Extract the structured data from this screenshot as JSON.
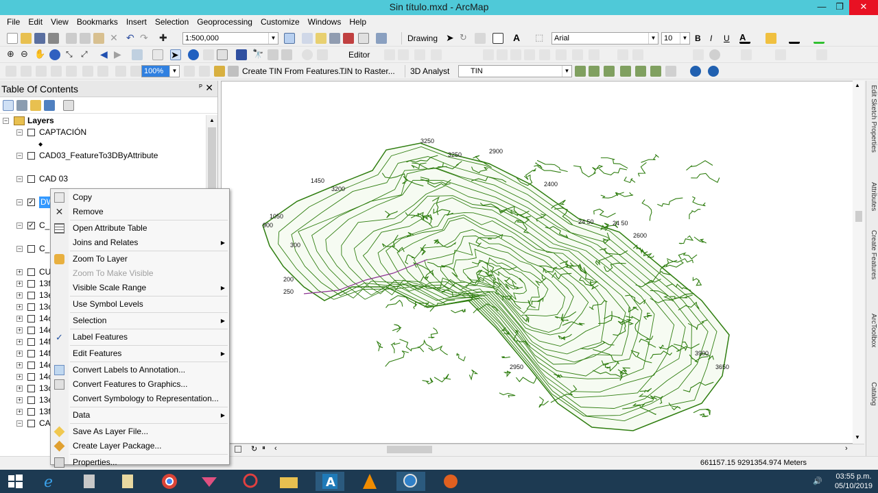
{
  "window": {
    "title": "Sin título.mxd - ArcMap",
    "minimize": "—",
    "maximize": "❐",
    "close": "✕"
  },
  "menu": [
    "File",
    "Edit",
    "View",
    "Bookmarks",
    "Insert",
    "Selection",
    "Geoprocessing",
    "Customize",
    "Windows",
    "Help"
  ],
  "toolbar1": {
    "scale": "1:500,000",
    "drawing": "Drawing",
    "font": "Arial",
    "font_size": "10",
    "bold": "B",
    "italic": "I",
    "underline": "U"
  },
  "toolbar2": {
    "editor": "Editor"
  },
  "toolbar3": {
    "zoom_value": "100%",
    "create_tin": "Create TIN From Features...",
    "tin_to_raster": "TIN to Raster...",
    "analyst": "3D Analyst",
    "tin_layer": "TIN"
  },
  "toc": {
    "title": "Table Of Contents",
    "pin": "ᴾ",
    "close": "✕",
    "root": "Layers",
    "rows": [
      {
        "name": "CAPTACIÓN",
        "exp": "−",
        "checked": false
      },
      {
        "name": "◆",
        "exp": "",
        "checked": null
      },
      {
        "name": "CAD03_FeatureTo3DByAttribute",
        "exp": "−",
        "checked": false
      },
      {
        "name": "CAD 03",
        "exp": "−",
        "checked": false
      },
      {
        "name": "DW",
        "exp": "−",
        "checked": true,
        "selected": true
      },
      {
        "name": "C_",
        "exp": "−",
        "checked": true
      },
      {
        "name": "C_C",
        "exp": "−",
        "checked": false
      },
      {
        "name": "CU",
        "exp": "+",
        "checked": false
      },
      {
        "name": "13f",
        "exp": "+",
        "checked": false
      },
      {
        "name": "13e",
        "exp": "+",
        "checked": false
      },
      {
        "name": "13c",
        "exp": "+",
        "checked": false
      },
      {
        "name": "14c",
        "exp": "+",
        "checked": false
      },
      {
        "name": "14e",
        "exp": "+",
        "checked": false
      },
      {
        "name": "14f",
        "exp": "+",
        "checked": false
      },
      {
        "name": "14f",
        "exp": "+",
        "checked": false
      },
      {
        "name": "14e",
        "exp": "+",
        "checked": false
      },
      {
        "name": "14c",
        "exp": "+",
        "checked": false
      },
      {
        "name": "13c",
        "exp": "+",
        "checked": false
      },
      {
        "name": "13e",
        "exp": "+",
        "checked": false
      },
      {
        "name": "13f",
        "exp": "+",
        "checked": false
      },
      {
        "name": "CA",
        "exp": "−",
        "checked": false
      }
    ]
  },
  "context_menu": {
    "items": [
      {
        "label": "Copy",
        "icon": "copy-icon",
        "sub": false,
        "disabled": false
      },
      {
        "label": "Remove",
        "icon": "remove-icon",
        "sub": false,
        "disabled": false
      },
      {
        "sep": true
      },
      {
        "label": "Open Attribute Table",
        "icon": "table-icon",
        "sub": false,
        "disabled": false
      },
      {
        "label": "Joins and Relates",
        "icon": "",
        "sub": true,
        "disabled": false
      },
      {
        "sep": true
      },
      {
        "label": "Zoom To Layer",
        "icon": "zoom-layer-icon",
        "sub": false,
        "disabled": false
      },
      {
        "label": "Zoom To Make Visible",
        "icon": "",
        "sub": false,
        "disabled": true
      },
      {
        "label": "Visible Scale Range",
        "icon": "",
        "sub": true,
        "disabled": false
      },
      {
        "sep": true
      },
      {
        "label": "Use Symbol Levels",
        "icon": "",
        "sub": false,
        "disabled": false
      },
      {
        "sep": true
      },
      {
        "label": "Selection",
        "icon": "",
        "sub": true,
        "disabled": false
      },
      {
        "sep": true
      },
      {
        "label": "Label Features",
        "icon": "check-icon",
        "sub": false,
        "disabled": false
      },
      {
        "sep": true
      },
      {
        "label": "Edit Features",
        "icon": "",
        "sub": true,
        "disabled": false
      },
      {
        "sep": true
      },
      {
        "label": "Convert Labels to Annotation...",
        "icon": "annotation-icon",
        "sub": false,
        "disabled": false
      },
      {
        "label": "Convert Features to Graphics...",
        "icon": "graphics-icon",
        "sub": false,
        "disabled": false
      },
      {
        "label": "Convert Symbology to Representation...",
        "icon": "",
        "sub": false,
        "disabled": false
      },
      {
        "sep": true
      },
      {
        "label": "Data",
        "icon": "",
        "sub": true,
        "disabled": false
      },
      {
        "sep": true
      },
      {
        "label": "Save As Layer File...",
        "icon": "layer-file-icon",
        "sub": false,
        "disabled": false
      },
      {
        "label": "Create Layer Package...",
        "icon": "layer-package-icon",
        "sub": false,
        "disabled": false
      },
      {
        "sep": true
      },
      {
        "label": "Properties...",
        "icon": "properties-icon",
        "sub": false,
        "disabled": false
      }
    ]
  },
  "map": {
    "contour_labels": [
      "3250",
      "3250",
      "2900",
      "1450",
      "1050",
      "3200",
      "900",
      "2400",
      "24 50",
      "24 50",
      "2600",
      "300",
      "200",
      "250",
      "3900",
      "2950",
      "3650"
    ],
    "contour_color": "#2e7d0f"
  },
  "dock_tabs": [
    "Edit Sketch Properties",
    "Attributes",
    "Create Features",
    "ArcToolbox",
    "Catalog"
  ],
  "status": {
    "coords": "661157.15  9291354.974 Meters"
  },
  "taskbar": {
    "time": "03:55 p.m.",
    "date": "05/10/2019"
  }
}
